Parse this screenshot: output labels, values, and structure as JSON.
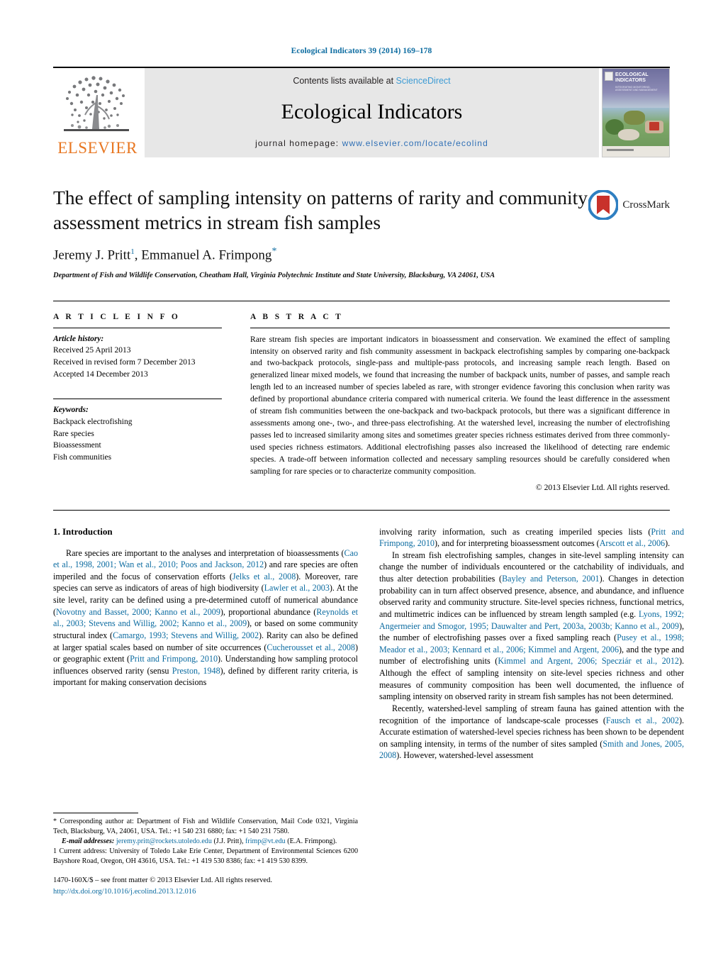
{
  "running_head": "Ecological Indicators 39 (2014) 169–178",
  "masthead": {
    "publisher_name": "ELSEVIER",
    "contents_prefix": "Contents lists available at ",
    "contents_link": "ScienceDirect",
    "journal_name": "Ecological Indicators",
    "homepage_prefix": "journal homepage: ",
    "homepage_url": "www.elsevier.com/locate/ecolind",
    "cover_title": "ECOLOGICAL INDICATORS",
    "cover_subtitle": "INTEGRATING MONITORING, ASSESSMENT AND MANAGEMENT"
  },
  "article": {
    "title": "The effect of sampling intensity on patterns of rarity and community assessment metrics in stream fish samples",
    "author_1": "Jeremy J. Pritt",
    "author_1_sup": "1",
    "author_2": "Emmanuel A. Frimpong",
    "author_2_sup": "*",
    "affiliation": "Department of Fish and Wildlife Conservation, Cheatham Hall, Virginia Polytechnic Institute and State University, Blacksburg, VA 24061, USA",
    "crossmark_label": "CrossMark"
  },
  "info": {
    "heading": "A R T I C L E   I N F O",
    "history_label": "Article history:",
    "history": [
      "Received 25 April 2013",
      "Received in revised form 7 December 2013",
      "Accepted 14 December 2013"
    ],
    "keywords_label": "Keywords:",
    "keywords": [
      "Backpack electrofishing",
      "Rare species",
      "Bioassessment",
      "Fish communities"
    ]
  },
  "abstract": {
    "heading": "A B S T R A C T",
    "text": "Rare stream fish species are important indicators in bioassessment and conservation. We examined the effect of sampling intensity on observed rarity and fish community assessment in backpack electrofishing samples by comparing one-backpack and two-backpack protocols, single-pass and multiple-pass protocols, and increasing sample reach length. Based on generalized linear mixed models, we found that increasing the number of backpack units, number of passes, and sample reach length led to an increased number of species labeled as rare, with stronger evidence favoring this conclusion when rarity was defined by proportional abundance criteria compared with numerical criteria. We found the least difference in the assessment of stream fish communities between the one-backpack and two-backpack protocols, but there was a significant difference in assessments among one-, two-, and three-pass electrofishing. At the watershed level, increasing the number of electrofishing passes led to increased similarity among sites and sometimes greater species richness estimates derived from three commonly-used species richness estimators. Additional electrofishing passes also increased the likelihood of detecting rare endemic species. A trade-off between information collected and necessary sampling resources should be carefully considered when sampling for rare species or to characterize community composition.",
    "copyright": "© 2013 Elsevier Ltd. All rights reserved."
  },
  "body": {
    "section_number_title": "1.  Introduction",
    "left_para_1": [
      {
        "t": "Rare species are important to the analyses and interpretation of bioassessments ("
      },
      {
        "t": "Cao et al., 1998, 2001; Wan et al., 2010; Poos and Jackson, 2012",
        "link": true
      },
      {
        "t": ") and rare species are often imperiled and the focus of conservation efforts ("
      },
      {
        "t": "Jelks et al., 2008",
        "link": true
      },
      {
        "t": "). Moreover, rare species can serve as indicators of areas of high biodiversity ("
      },
      {
        "t": "Lawler et al., 2003",
        "link": true
      },
      {
        "t": "). At the site level, rarity can be defined using a pre-determined cutoff of numerical abundance ("
      },
      {
        "t": "Novotny and Basset, 2000; Kanno et al., 2009",
        "link": true
      },
      {
        "t": "), proportional abundance ("
      },
      {
        "t": "Reynolds et al., 2003; Stevens and Willig, 2002; Kanno et al., 2009",
        "link": true
      },
      {
        "t": "), or based on some community structural index ("
      },
      {
        "t": "Camargo, 1993; Stevens and Willig, 2002",
        "link": true
      },
      {
        "t": "). Rarity can also be defined at larger spatial scales based on number of site occurrences ("
      },
      {
        "t": "Cucherousset et al., 2008",
        "link": true
      },
      {
        "t": ") or geographic extent ("
      },
      {
        "t": "Pritt and Frimpong, 2010",
        "link": true
      },
      {
        "t": "). Understanding how sampling protocol influences observed rarity (sensu "
      },
      {
        "t": "Preston, 1948",
        "link": true
      },
      {
        "t": "), defined by different rarity criteria, is important for making conservation decisions"
      }
    ],
    "right_para_1": [
      {
        "t": "involving rarity information, such as creating imperiled species lists ("
      },
      {
        "t": "Pritt and Frimpong, 2010",
        "link": true
      },
      {
        "t": "), and for interpreting bioassessment outcomes ("
      },
      {
        "t": "Arscott et al., 2006",
        "link": true
      },
      {
        "t": ")."
      }
    ],
    "right_para_2": [
      {
        "t": "In stream fish electrofishing samples, changes in site-level sampling intensity can change the number of individuals encountered or the catchability of individuals, and thus alter detection probabilities ("
      },
      {
        "t": "Bayley and Peterson, 2001",
        "link": true
      },
      {
        "t": "). Changes in detection probability can in turn affect observed presence, absence, and abundance, and influence observed rarity and community structure. Site-level species richness, functional metrics, and multimetric indices can be influenced by stream length sampled (e.g. "
      },
      {
        "t": "Lyons, 1992; Angermeier and Smogor, 1995; Dauwalter and Pert, 2003a, 2003b; Kanno et al., 2009",
        "link": true
      },
      {
        "t": "), the number of electrofishing passes over a fixed sampling reach ("
      },
      {
        "t": "Pusey et al., 1998; Meador et al., 2003; Kennard et al., 2006; Kimmel and Argent, 2006",
        "link": true
      },
      {
        "t": "), and the type and number of electrofishing units ("
      },
      {
        "t": "Kimmel and Argent, 2006; Specziár et al., 2012",
        "link": true
      },
      {
        "t": "). Although the effect of sampling intensity on site-level species richness and other measures of community composition has been well documented, the influence of sampling intensity on observed rarity in stream fish samples has not been determined."
      }
    ],
    "right_para_3": [
      {
        "t": "Recently, watershed-level sampling of stream fauna has gained attention with the recognition of the importance of landscape-scale processes ("
      },
      {
        "t": "Fausch et al., 2002",
        "link": true
      },
      {
        "t": "). Accurate estimation of watershed-level species richness has been shown to be dependent on sampling intensity, in terms of the number of sites sampled ("
      },
      {
        "t": "Smith and Jones, 2005, 2008",
        "link": true
      },
      {
        "t": "). However, watershed-level assessment"
      }
    ]
  },
  "footnotes": {
    "corresponding": "* Corresponding author at: Department of Fish and Wildlife Conservation, Mail Code 0321, Virginia Tech, Blacksburg, VA, 24061, USA. Tel.: +1 540 231 6880; fax: +1 540 231 7580.",
    "email_label": "E-mail addresses:",
    "email_1": "jeremy.pritt@rockets.utoledo.edu",
    "email_1_owner": "(J.J. Pritt),",
    "email_2": "frimp@vt.edu",
    "email_2_owner": "(E.A. Frimpong).",
    "current_address": "1  Current address: University of Toledo Lake Erie Center, Department of Environmental Sciences 6200 Bayshore Road, Oregon, OH 43616, USA. Tel.: +1 419 530 8386; fax: +1 419 530 8399."
  },
  "page_footer": {
    "issn_line": "1470-160X/$ – see front matter © 2013 Elsevier Ltd. All rights reserved.",
    "doi": "http://dx.doi.org/10.1016/j.ecolind.2013.12.016"
  }
}
